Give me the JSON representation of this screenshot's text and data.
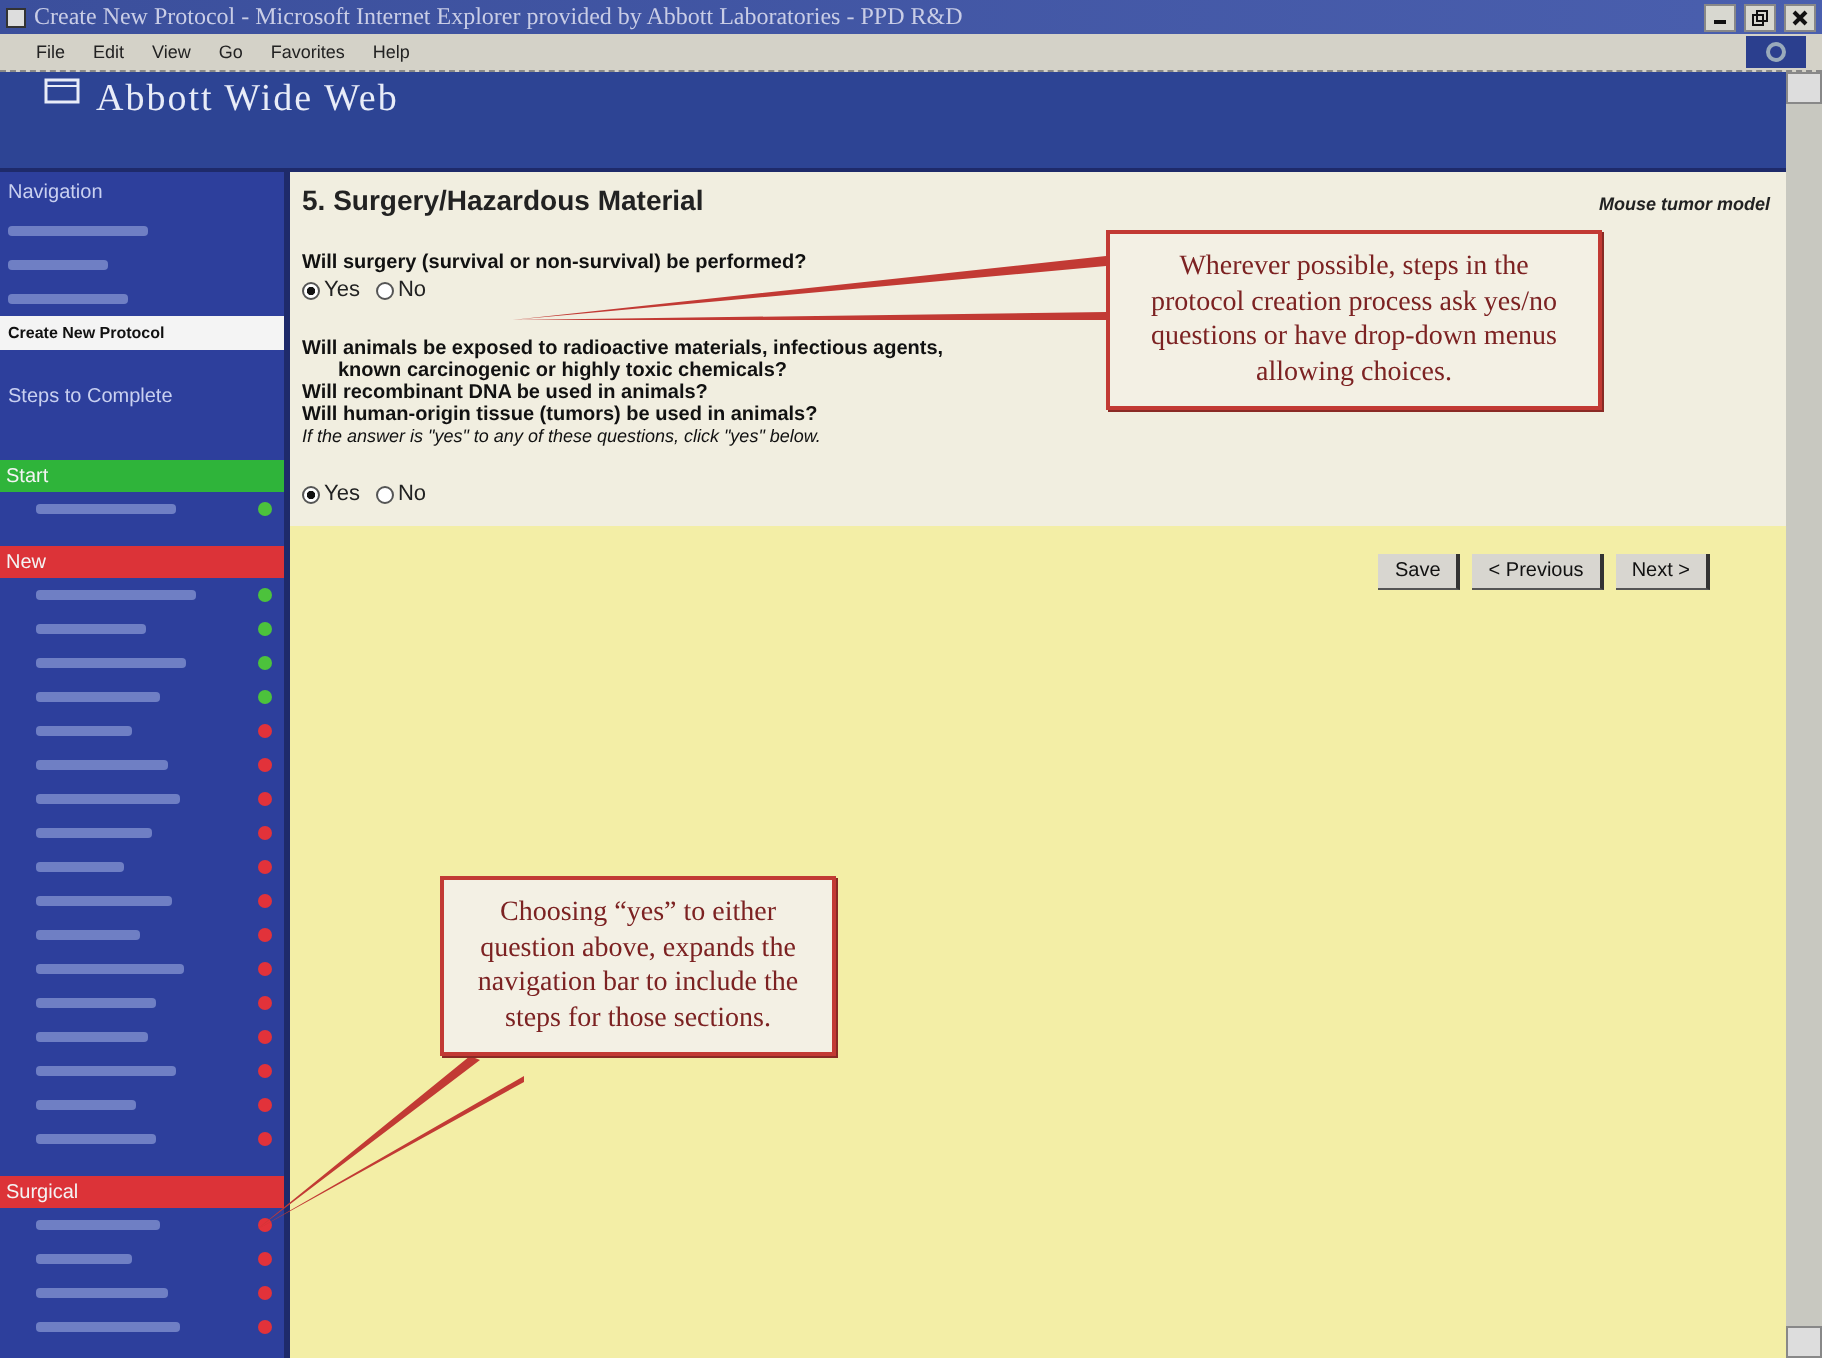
{
  "window": {
    "title": "Create New Protocol - Microsoft Internet Explorer provided by Abbott Laboratories - PPD R&D"
  },
  "menu": [
    "File",
    "Edit",
    "View",
    "Go",
    "Favorites",
    "Help"
  ],
  "banner": {
    "title": "Abbott Wide Web"
  },
  "sidebar": {
    "title": "Navigation",
    "links": [
      {
        "kind": "smudged",
        "selected": false
      },
      {
        "kind": "smudged",
        "selected": false
      },
      {
        "kind": "smudged",
        "selected": false
      },
      {
        "kind": "link",
        "label": "Create New Protocol",
        "selected": true
      }
    ],
    "steps_title": "Steps to Complete",
    "sections": [
      {
        "title": "Start",
        "color": "#2fb43a",
        "steps": [
          {
            "color": "#4cc23c"
          }
        ]
      },
      {
        "title": "New",
        "color": "#dc3338",
        "steps": [
          {
            "color": "#4cc23c"
          },
          {
            "color": "#4cc23c"
          },
          {
            "color": "#4cc23c"
          },
          {
            "color": "#4cc23c"
          },
          {
            "color": "#e2323a"
          },
          {
            "color": "#e2323a"
          },
          {
            "color": "#e2323a"
          },
          {
            "color": "#e2323a"
          },
          {
            "color": "#e2323a"
          },
          {
            "color": "#e2323a"
          },
          {
            "color": "#e2323a"
          },
          {
            "color": "#e2323a"
          },
          {
            "color": "#e2323a"
          },
          {
            "color": "#e2323a"
          },
          {
            "color": "#e2323a"
          },
          {
            "color": "#e2323a"
          },
          {
            "color": "#e2323a"
          }
        ]
      },
      {
        "title": "Surgical",
        "color": "#dc3338",
        "steps": [
          {
            "color": "#e2323a"
          },
          {
            "color": "#e2323a"
          },
          {
            "color": "#e2323a"
          },
          {
            "color": "#e2323a"
          }
        ]
      }
    ]
  },
  "content": {
    "heading": "5. Surgery/Hazardous Material",
    "model": "Mouse tumor model",
    "groups": [
      {
        "lines": [
          "Will surgery (survival or non-survival) be performed?"
        ],
        "options": [
          {
            "label": "Yes",
            "selected": true
          },
          {
            "label": "No",
            "selected": false
          }
        ]
      },
      {
        "lines": [
          "Will animals be exposed to radioactive materials, infectious agents,",
          "known carcinogenic or highly toxic chemicals?",
          "Will recombinant DNA be used in animals?",
          "Will human-origin tissue (tumors) be used in animals?"
        ],
        "indented": [
          false,
          true,
          false,
          false
        ],
        "note": "If the answer is \"yes\" to any of these questions, click \"yes\" below.",
        "options": [
          {
            "label": "Yes",
            "selected": true
          },
          {
            "label": "No",
            "selected": false
          }
        ]
      }
    ],
    "buttons": [
      "Save",
      "< Previous",
      "Next >"
    ]
  },
  "callouts": [
    "Wherever possible, steps in the protocol creation process ask yes/no questions or have drop-down menus allowing choices.",
    "Choosing “yes” to either question above, expands the navigation bar to include the steps for those sections."
  ]
}
